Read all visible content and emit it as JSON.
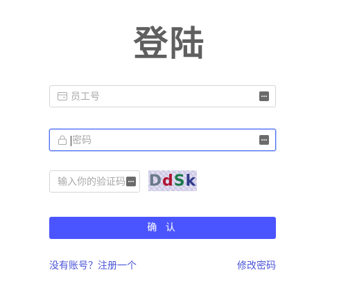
{
  "header": {
    "title": "登陆"
  },
  "form": {
    "employee_id": {
      "placeholder": "员工号",
      "icon": "id-card-icon"
    },
    "password": {
      "placeholder": "密码",
      "icon": "lock-icon"
    },
    "captcha": {
      "placeholder": "输入你的验证码",
      "image_text": [
        "D",
        "d",
        "S",
        "k"
      ]
    },
    "confirm_label": "确 认"
  },
  "footer": {
    "register_label": "没有账号？注册一个",
    "change_password_label": "修改密码"
  },
  "colors": {
    "accent": "#4b55ff",
    "link": "#4b55d8",
    "focus_border": "#4a6cf7"
  }
}
